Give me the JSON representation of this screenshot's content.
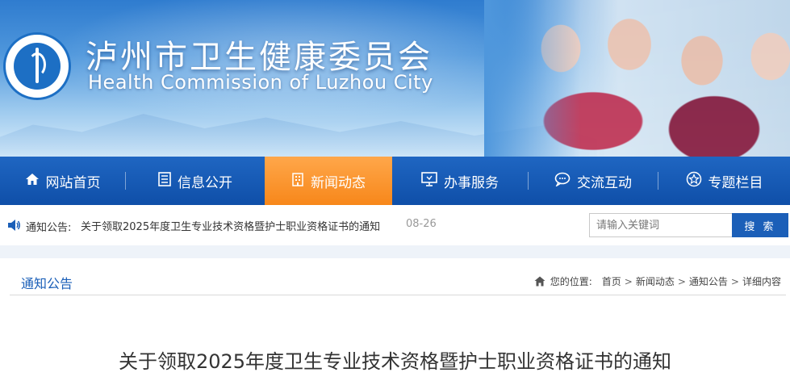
{
  "header": {
    "title": "泸州市卫生健康委员会",
    "subtitle": "Health Commission of Luzhou City",
    "logo_text": "Health Commission of Luzhou City"
  },
  "nav": {
    "items": [
      {
        "label": "网站首页",
        "icon": "home-icon"
      },
      {
        "label": "信息公开",
        "icon": "list-icon"
      },
      {
        "label": "新闻动态",
        "icon": "building-icon",
        "active": true
      },
      {
        "label": "办事服务",
        "icon": "monitor-icon"
      },
      {
        "label": "交流互动",
        "icon": "chat-icon"
      },
      {
        "label": "专题栏目",
        "icon": "star-icon"
      }
    ],
    "active_color": "#f7871a",
    "bar_color": "#0f4fa8"
  },
  "notice": {
    "label": "通知公告:",
    "text": "关于领取2025年度卫生专业技术资格暨护士职业资格证书的通知",
    "date": "08-26"
  },
  "search": {
    "placeholder": "请输入关键词",
    "button_label": "搜 索"
  },
  "section": {
    "title": "通知公告"
  },
  "breadcrumb": {
    "prefix": "您的位置:",
    "items": [
      "首页",
      "新闻动态",
      "通知公告",
      "详细内容"
    ],
    "separator": ">"
  },
  "article": {
    "title": "关于领取2025年度卫生专业技术资格暨护士职业资格证书的通知"
  }
}
